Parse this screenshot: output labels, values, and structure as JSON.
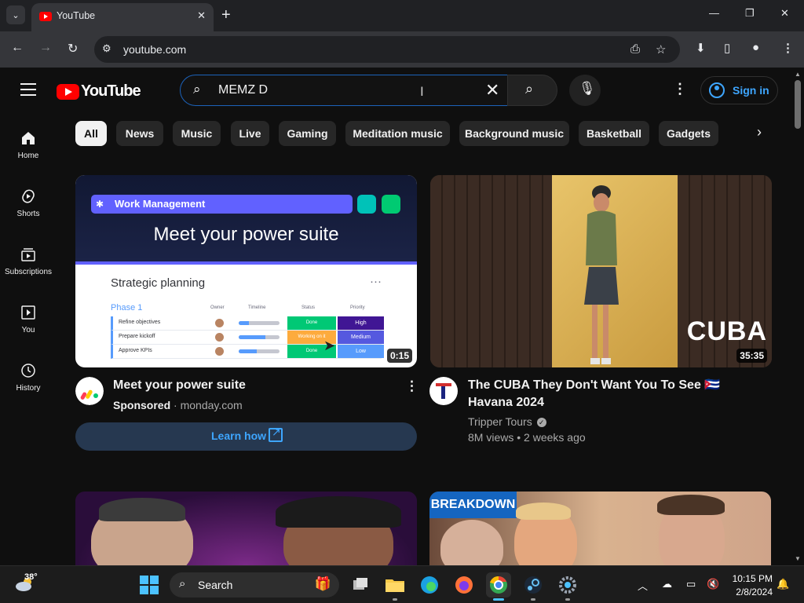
{
  "browser": {
    "tab_title": "YouTube",
    "url": "youtube.com"
  },
  "header": {
    "logo_text": "YouTube",
    "search_value": "MEMZ D",
    "sign_in": "Sign in"
  },
  "sidebar": {
    "items": [
      {
        "label": "Home",
        "icon": "home-icon"
      },
      {
        "label": "Shorts",
        "icon": "shorts-icon"
      },
      {
        "label": "Subscriptions",
        "icon": "subscriptions-icon"
      },
      {
        "label": "You",
        "icon": "you-icon"
      },
      {
        "label": "History",
        "icon": "history-icon"
      }
    ]
  },
  "chips": [
    "All",
    "News",
    "Music",
    "Live",
    "Gaming",
    "Meditation music",
    "Background music",
    "Basketball",
    "Gadgets"
  ],
  "videos": {
    "ad": {
      "title": "Meet your power suite",
      "sponsored": "Sponsored",
      "separator": "·",
      "advertiser": "monday.com",
      "duration": "0:15",
      "cta": "Learn how",
      "thumbnail": {
        "pill": "Work Management",
        "headline": "Meet your power suite",
        "board_title": "Strategic planning",
        "phase": "Phase 1",
        "columns": [
          "Owner",
          "Timeline",
          "Status",
          "Priority"
        ],
        "rows": [
          {
            "task": "Refine objectives",
            "status": "Done",
            "priority": "High",
            "status_color": "#00c875",
            "priority_color": "#401694",
            "timeline": 0.25
          },
          {
            "task": "Prepare kickoff",
            "status": "Working on it",
            "priority": "Medium",
            "status_color": "#fdab3d",
            "priority_color": "#5559df",
            "timeline": 0.65
          },
          {
            "task": "Approve KPIs",
            "status": "Done",
            "priority": "Low",
            "status_color": "#00c875",
            "priority_color": "#579bfc",
            "timeline": 0.45
          }
        ]
      }
    },
    "cuba": {
      "title": "The CUBA They Don't Want You To See 🇨🇺 Havana 2024",
      "channel": "Tripper Tours",
      "views": "8M views",
      "age": "2 weeks ago",
      "separator": "•",
      "duration": "35:35",
      "overlay_text": "CUBA"
    },
    "row2_right_badge": "BREAKDOWN"
  },
  "taskbar": {
    "temperature": "38°",
    "search_label": "Search",
    "time": "10:15 PM",
    "date": "2/8/2024"
  },
  "colors": {
    "accent_blue": "#3ea6ff",
    "youtube_red": "#ff0000",
    "background": "#0f0f0f"
  }
}
